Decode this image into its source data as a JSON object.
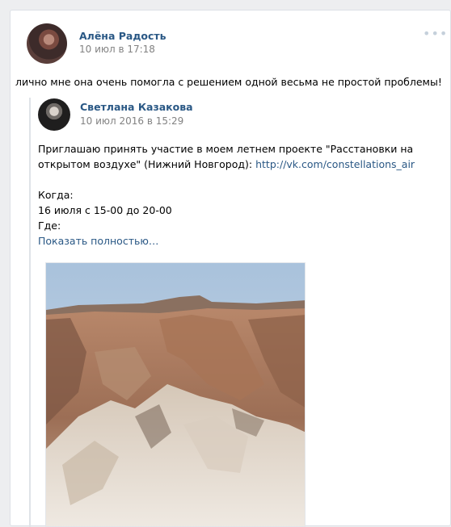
{
  "post": {
    "author_name": "Алёна Радость",
    "time": "10 июл в 17:18",
    "text": "лично мне она очень помогла с решением одной весьма не простой проблемы!"
  },
  "repost": {
    "author_name": "Светлана Казакова",
    "time": "10 июл 2016 в 15:29",
    "text_line1": "Приглашаю принять участие в моем летнем проекте \"Расстановки на открытом воздухе\" (Нижний Новгород): ",
    "link": "http://vk.com/constellations_air",
    "when_label": "Когда:",
    "when_value": "16 июля с 15-00 до 20-00",
    "where_label": "Где:",
    "show_more": "Показать полностью…"
  },
  "icons": {
    "more": "more-dots-icon"
  },
  "colors": {
    "link": "#2a5885",
    "meta": "#828282",
    "background": "#edeef0"
  }
}
